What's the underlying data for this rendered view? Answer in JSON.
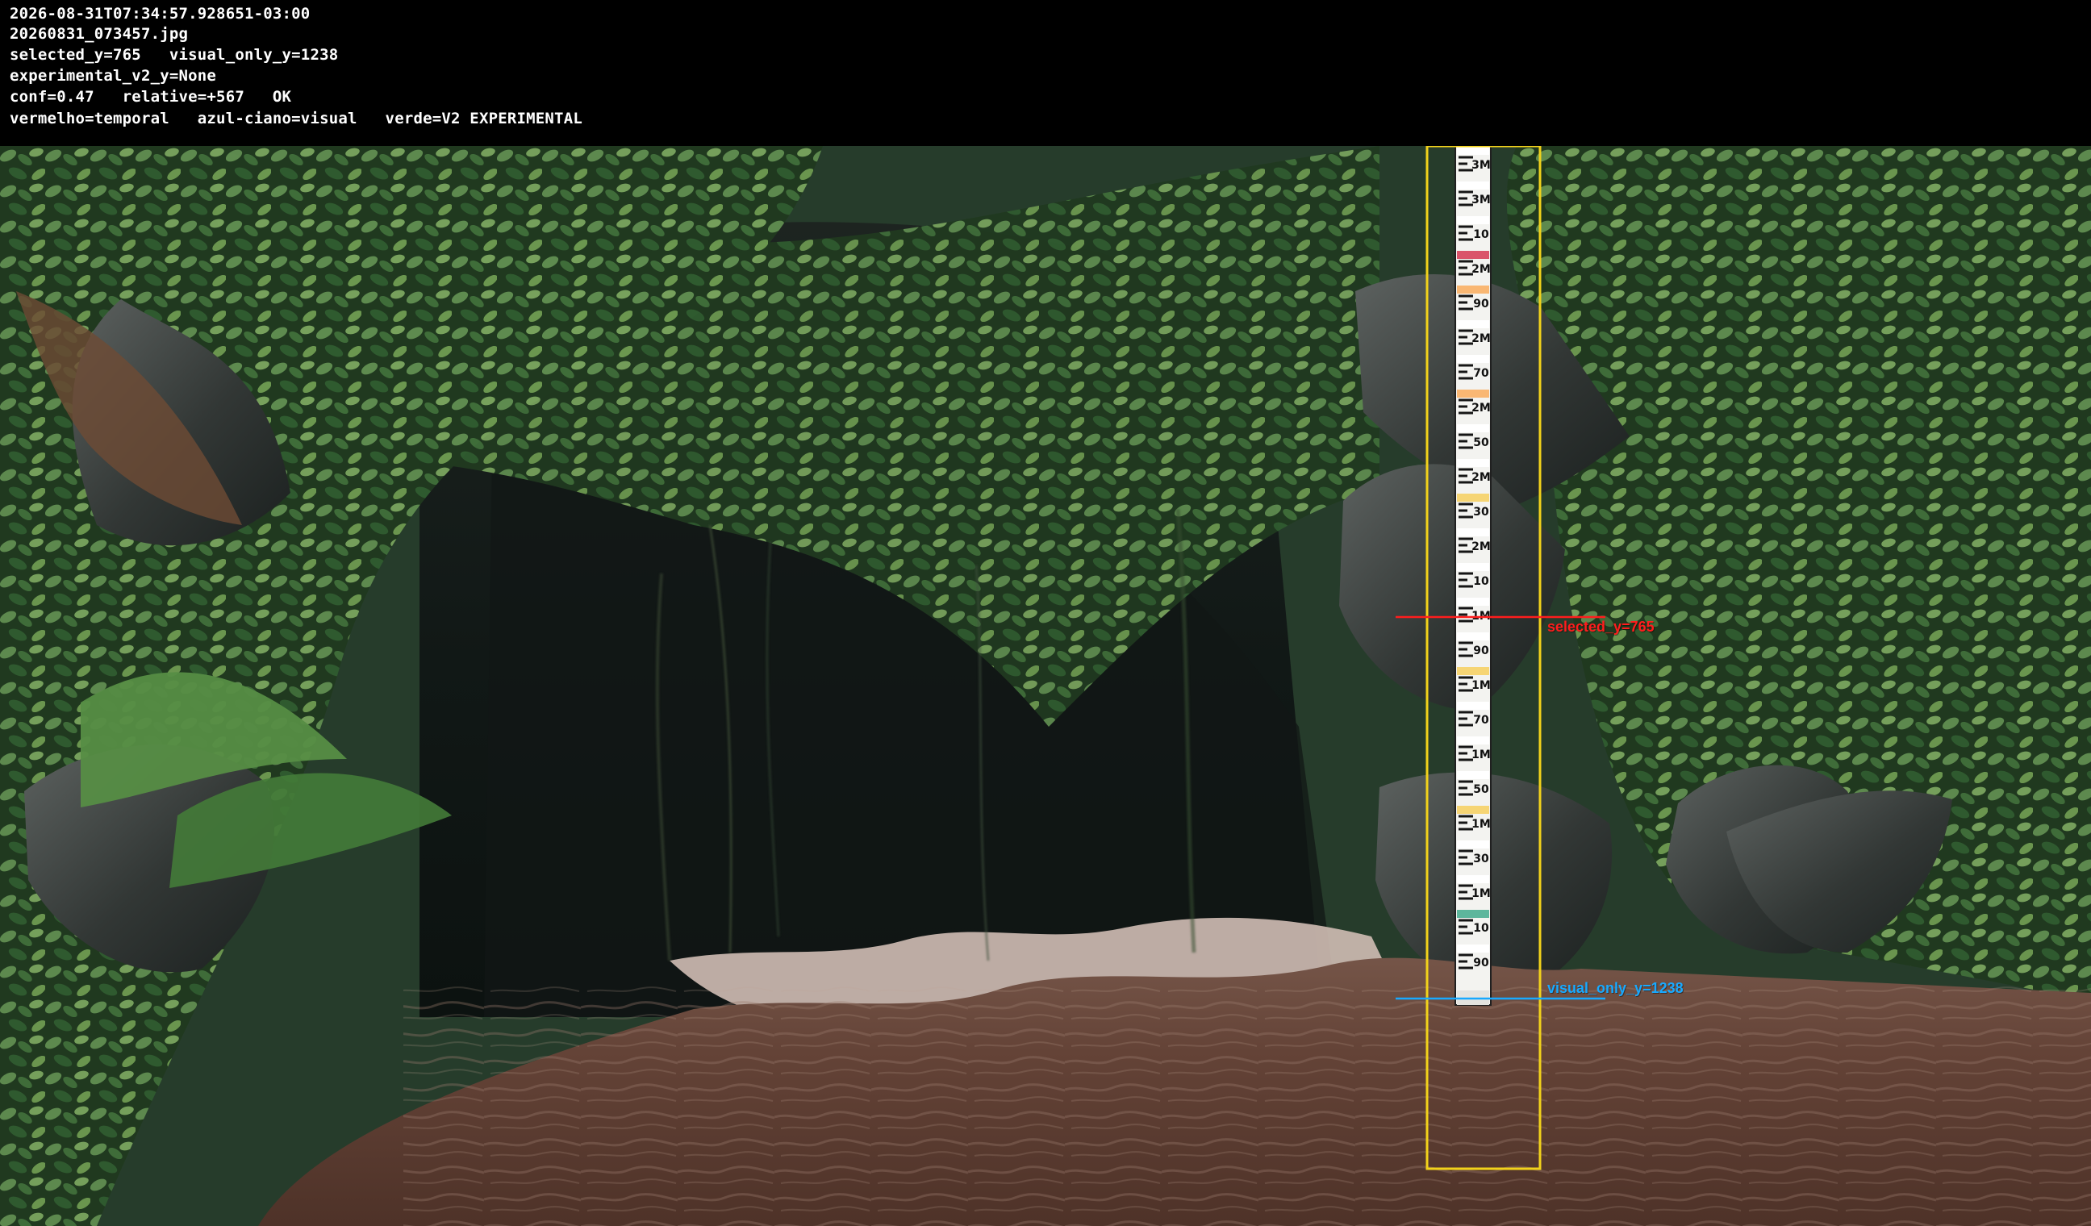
{
  "header": {
    "lines": [
      "2026-08-31T07:34:57.928651-03:00",
      "20260831_073457.jpg",
      "selected_y=765   visual_only_y=1238",
      "experimental_v2_y=None",
      "conf=0.47   relative=+567   OK",
      "vermelho=temporal   azul-ciano=visual   verde=V2 EXPERIMENTAL"
    ]
  },
  "overlays": {
    "selected_label": "selected_y=765",
    "visual_label": "visual_only_y=1238",
    "selected_color": "#ff1d1d",
    "visual_color": "#18a9ff",
    "roi_color": "#f2d21b"
  },
  "gauge": {
    "labels": [
      "3M",
      "3M",
      "10",
      "2M",
      "90",
      "2M",
      "70",
      "2M",
      "50",
      "2M",
      "30",
      "2M",
      "10",
      "1M",
      "90",
      "1M",
      "70",
      "1M",
      "50",
      "1M",
      "30",
      "1M",
      "10",
      "90"
    ]
  }
}
